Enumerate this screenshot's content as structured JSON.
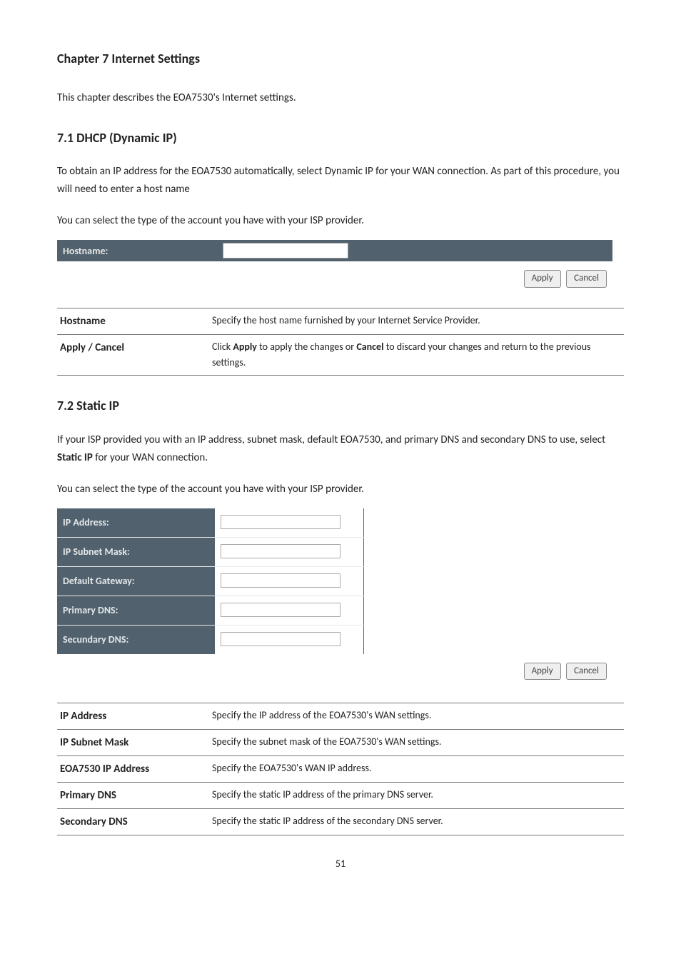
{
  "chapter_title": "Chapter 7 Internet Settings",
  "intro_para": "This chapter describes the EOA7530's Internet settings.",
  "sec71": {
    "title": "7.1 DHCP (Dynamic IP)",
    "para": "To obtain an IP address for the EOA7530 automatically, select Dynamic IP for your WAN connection. As part of this procedure, you will need to enter a host name",
    "isp_line": "You can select the type of the account you have with your ISP provider.",
    "hostname_label": "Hostname:",
    "hostname_value": "",
    "apply": "Apply",
    "cancel": "Cancel",
    "defs": [
      {
        "term": "Hostname",
        "desc": "Specify the host name furnished by your Internet Service Provider."
      },
      {
        "term": "Apply / Cancel",
        "desc_pre": "Click ",
        "desc_b1": "Apply",
        "desc_mid": " to apply the changes or ",
        "desc_b2": "Cancel",
        "desc_post": " to discard your changes and return to the previous settings."
      }
    ]
  },
  "sec72": {
    "title": "7.2 Static IP",
    "para_pre": "If your ISP provided you with an IP address, subnet mask, default EOA7530, and primary DNS and secondary DNS to use, select ",
    "para_b": "Static IP",
    "para_post": " for your WAN connection.",
    "isp_line": "You can select the type of the account you have with your ISP provider.",
    "fields": [
      {
        "label": "IP Address:",
        "value": ""
      },
      {
        "label": "IP Subnet Mask:",
        "value": ""
      },
      {
        "label": "Default Gateway:",
        "value": ""
      },
      {
        "label": "Primary DNS:",
        "value": ""
      },
      {
        "label": "Secundary DNS:",
        "value": ""
      }
    ],
    "apply": "Apply",
    "cancel": "Cancel",
    "defs": [
      {
        "term": "IP Address",
        "desc": "Specify the IP address of the EOA7530's WAN settings."
      },
      {
        "term": "IP Subnet Mask",
        "desc": "Specify the subnet mask of the EOA7530's WAN settings."
      },
      {
        "term": "EOA7530 IP Address",
        "desc": "Specify the EOA7530's WAN IP address."
      },
      {
        "term": "Primary DNS",
        "desc": "Specify the static IP address of the primary DNS server."
      },
      {
        "term": "Secondary DNS",
        "desc": "Specify the static IP address of the secondary DNS server."
      }
    ]
  },
  "page_number": "51"
}
